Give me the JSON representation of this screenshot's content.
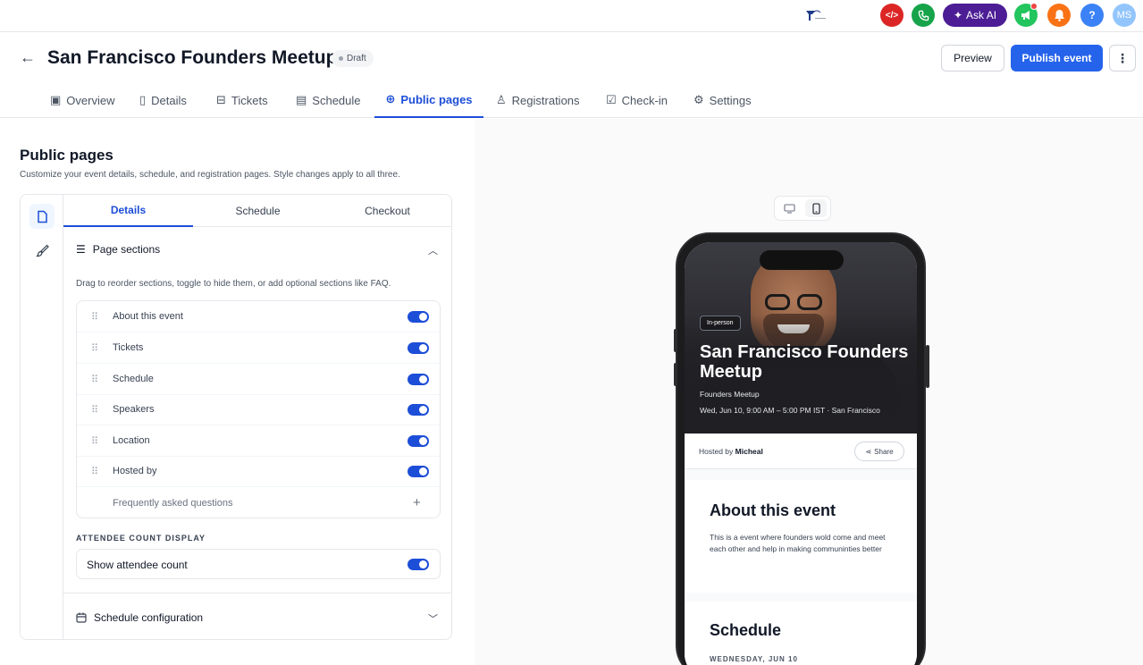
{
  "topbar": {
    "brand_text": "T",
    "dev_icon": "code-icon",
    "ask_ai_label": "Ask AI",
    "avatar_initials": "MS",
    "colors": {
      "dev": "#dc2626",
      "phone": "#16a34a",
      "ask_ai": "#4c1d95",
      "announce": "#22c55e",
      "bell": "#f97316",
      "help": "#3b82f6",
      "avatar": "#93c5fd"
    }
  },
  "header": {
    "title": "San Francisco Founders Meetup",
    "status": "Draft",
    "preview_label": "Preview",
    "publish_label": "Publish event"
  },
  "tabs": [
    {
      "label": "Overview",
      "icon": "layout-icon"
    },
    {
      "label": "Details",
      "icon": "document-icon"
    },
    {
      "label": "Tickets",
      "icon": "ticket-icon"
    },
    {
      "label": "Schedule",
      "icon": "calendar-icon"
    },
    {
      "label": "Public pages",
      "icon": "globe-icon",
      "active": true
    },
    {
      "label": "Registrations",
      "icon": "users-icon"
    },
    {
      "label": "Check-in",
      "icon": "checkbox-icon"
    },
    {
      "label": "Settings",
      "icon": "gear-icon"
    }
  ],
  "public_pages": {
    "title": "Public pages",
    "subtitle": "Customize your event details, schedule, and registration pages. Style changes apply to all three.",
    "subtabs": [
      "Details",
      "Schedule",
      "Checkout"
    ],
    "active_subtab": "Details",
    "page_sections": {
      "title": "Page sections",
      "description": "Drag to reorder sections, toggle to hide them, or add optional sections like FAQ.",
      "items": [
        {
          "label": "About this event",
          "enabled": true
        },
        {
          "label": "Tickets",
          "enabled": true
        },
        {
          "label": "Schedule",
          "enabled": true
        },
        {
          "label": "Speakers",
          "enabled": true
        },
        {
          "label": "Location",
          "enabled": true
        },
        {
          "label": "Hosted by",
          "enabled": true
        }
      ],
      "optional_item": "Frequently asked questions"
    },
    "attendee_count": {
      "label": "ATTENDEE COUNT DISPLAY",
      "toggle_label": "Show attendee count",
      "enabled": true
    },
    "schedule_config": {
      "title": "Schedule configuration"
    }
  },
  "preview": {
    "chip": "In-person",
    "event_title": "San Francisco Founders Meetup",
    "series": "Founders Meetup",
    "when": "Wed, Jun 10, 9:00 AM – 5:00 PM IST · San Francisco",
    "hosted_prefix": "Hosted by",
    "host_name": "Micheal",
    "share_label": "Share",
    "about_title": "About this event",
    "about_body": "This is a event where founders wold come and meet each other and help in making communinties better",
    "schedule_title": "Schedule",
    "schedule_day": "WEDNESDAY, JUN 10"
  },
  "accent_color": "#2563eb"
}
